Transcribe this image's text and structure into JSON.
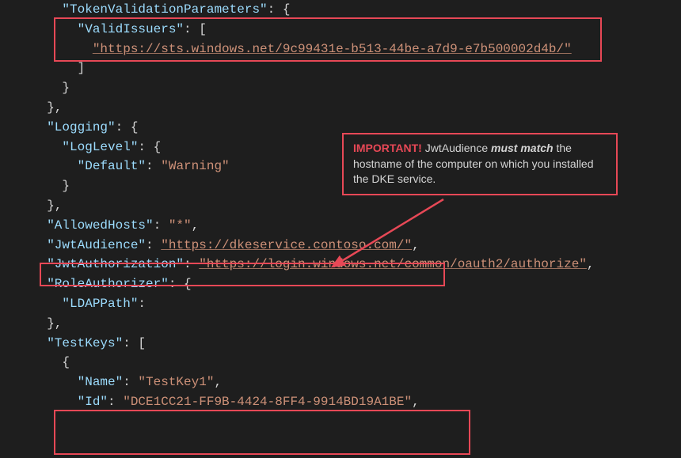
{
  "code": {
    "keys": {
      "tokenValidationParameters": "\"TokenValidationParameters\"",
      "validIssuers": "\"ValidIssuers\"",
      "logging": "\"Logging\"",
      "logLevel": "\"LogLevel\"",
      "default": "\"Default\"",
      "allowedHosts": "\"AllowedHosts\"",
      "jwtAudience": "\"JwtAudience\"",
      "jwtAuthorization": "\"JwtAuthorization\"",
      "roleAuthorizer": "\"RoleAuthorizer\"",
      "ldapPath": "\"LDAPPath\"",
      "testKeys": "\"TestKeys\"",
      "name": "\"Name\"",
      "id": "\"Id\""
    },
    "values": {
      "validIssuerUrl": "\"https://sts.windows.net/9c99431e-b513-44be-a7d9-e7b500002d4b/\"",
      "defaultLogLevel": "\"Warning\"",
      "allowedHosts": "\"*\"",
      "jwtAudience": "\"https://dkeservice.contoso.com/\"",
      "jwtAuthorization": "\"https://login.windows.net/common/oauth2/authorize\"",
      "testKeyName": "\"TestKey1\"",
      "testKeyId": "\"DCE1CC21-FF9B-4424-8FF4-9914BD19A1BE\""
    }
  },
  "callout": {
    "important": "IMPORTANT!",
    "text1": " JwtAudience ",
    "mustMatch": "must match",
    "text2": " the hostname of the computer on which you installed the DKE service."
  }
}
